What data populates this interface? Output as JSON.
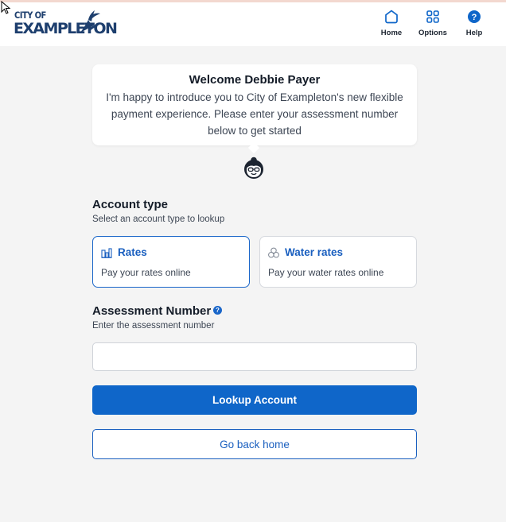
{
  "brand": {
    "logo_line1": "CITY OF",
    "logo_line2": "EXAMPLETON",
    "color": "#1e3f6e",
    "accent": "#0f66c9"
  },
  "nav": {
    "items": [
      {
        "label": "Home",
        "icon": "home-icon"
      },
      {
        "label": "Options",
        "icon": "grid-icon"
      },
      {
        "label": "Help",
        "icon": "help-icon"
      }
    ]
  },
  "welcome": {
    "title": "Welcome Debbie Payer",
    "message": "I'm happy to introduce you to City of Exampleton's new flexible payment experience. Please enter your assessment number below to get started"
  },
  "account_type": {
    "title": "Account type",
    "subtitle": "Select an account type to lookup",
    "options": [
      {
        "label": "Rates",
        "description": "Pay your rates online",
        "icon": "building-chart-icon",
        "selected": true
      },
      {
        "label": "Water rates",
        "description": "Pay your water rates online",
        "icon": "water-drops-icon",
        "selected": false
      }
    ]
  },
  "assessment": {
    "title": "Assessment Number",
    "subtitle": "Enter the assessment number",
    "value": "",
    "placeholder": ""
  },
  "buttons": {
    "lookup": "Lookup Account",
    "back": "Go back home"
  }
}
